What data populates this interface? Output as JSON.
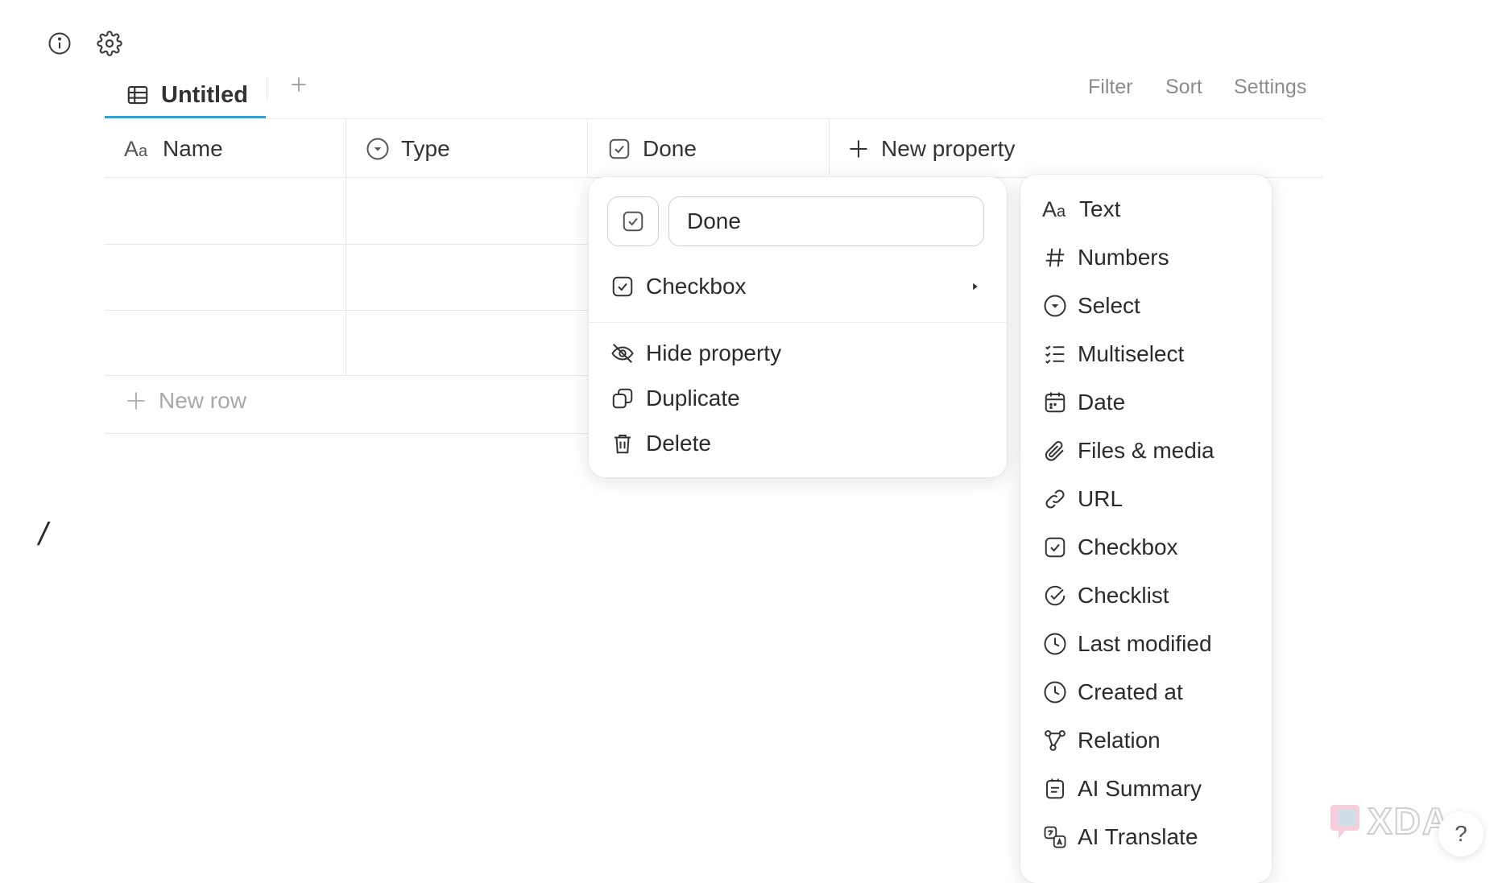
{
  "toolbar": {
    "info_icon": "info-icon",
    "settings_icon": "gear-icon"
  },
  "view_tab": {
    "label": "Untitled",
    "icon": "table-icon"
  },
  "view_actions": {
    "filter": "Filter",
    "sort": "Sort",
    "settings": "Settings"
  },
  "columns": [
    {
      "label": "Name",
      "icon": "text-type-icon"
    },
    {
      "label": "Type",
      "icon": "select-icon"
    },
    {
      "label": "Done",
      "icon": "checkbox-icon"
    },
    {
      "label": "New property",
      "icon": "plus-icon"
    }
  ],
  "table": {
    "new_row_label": "New row"
  },
  "editor": {
    "slash": "/"
  },
  "property_menu": {
    "name_value": "Done",
    "type_label": "Checkbox",
    "actions": [
      {
        "label": "Hide property",
        "icon": "eye-off-icon"
      },
      {
        "label": "Duplicate",
        "icon": "duplicate-icon"
      },
      {
        "label": "Delete",
        "icon": "trash-icon"
      }
    ]
  },
  "type_menu": {
    "items": [
      {
        "label": "Text",
        "icon": "text-type-icon"
      },
      {
        "label": "Numbers",
        "icon": "hash-icon"
      },
      {
        "label": "Select",
        "icon": "select-icon"
      },
      {
        "label": "Multiselect",
        "icon": "multiselect-icon"
      },
      {
        "label": "Date",
        "icon": "calendar-icon"
      },
      {
        "label": "Files & media",
        "icon": "paperclip-icon"
      },
      {
        "label": "URL",
        "icon": "link-icon"
      },
      {
        "label": "Checkbox",
        "icon": "checkbox-icon"
      },
      {
        "label": "Checklist",
        "icon": "checklist-icon"
      },
      {
        "label": "Last modified",
        "icon": "clock-icon"
      },
      {
        "label": "Created at",
        "icon": "clock-icon"
      },
      {
        "label": "Relation",
        "icon": "relation-icon"
      },
      {
        "label": "AI Summary",
        "icon": "ai-summary-icon"
      },
      {
        "label": "AI Translate",
        "icon": "ai-translate-icon"
      }
    ]
  },
  "help": {
    "label": "?"
  }
}
